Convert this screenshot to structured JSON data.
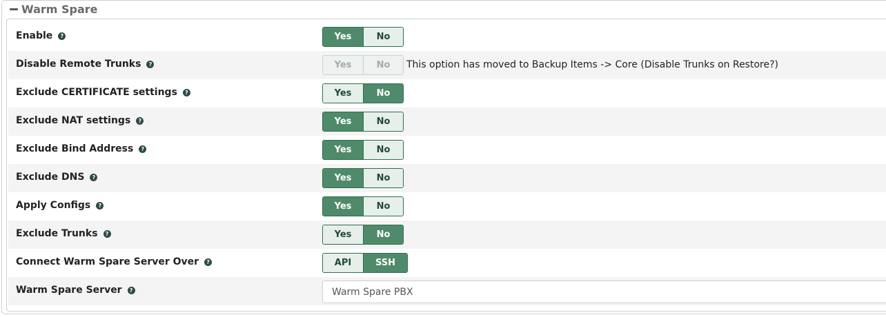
{
  "section": {
    "title": "Warm Spare"
  },
  "rows": [
    {
      "label": "Enable",
      "options": [
        "Yes",
        "No"
      ],
      "selected": "Yes"
    },
    {
      "label": "Disable Remote Trunks",
      "options": [
        "Yes",
        "No"
      ],
      "selected": null,
      "disabled": true,
      "note": "This option has moved to Backup Items -> Core (Disable Trunks on Restore?)"
    },
    {
      "label": "Exclude CERTIFICATE settings",
      "options": [
        "Yes",
        "No"
      ],
      "selected": "No"
    },
    {
      "label": "Exclude NAT settings",
      "options": [
        "Yes",
        "No"
      ],
      "selected": "Yes"
    },
    {
      "label": "Exclude Bind Address",
      "options": [
        "Yes",
        "No"
      ],
      "selected": "Yes"
    },
    {
      "label": "Exclude DNS",
      "options": [
        "Yes",
        "No"
      ],
      "selected": "Yes"
    },
    {
      "label": "Apply Configs",
      "options": [
        "Yes",
        "No"
      ],
      "selected": "Yes"
    },
    {
      "label": "Exclude Trunks",
      "options": [
        "Yes",
        "No"
      ],
      "selected": "No"
    },
    {
      "label": "Connect Warm Spare Server Over",
      "options": [
        "API",
        "SSH"
      ],
      "selected": "SSH"
    },
    {
      "label": "Warm Spare Server",
      "value": "Warm Spare PBX"
    }
  ],
  "help_icon": "question-circle-icon",
  "colors": {
    "active": "#4f8a6b",
    "inactive": "#e6efe9",
    "border": "#2f6d4f"
  }
}
